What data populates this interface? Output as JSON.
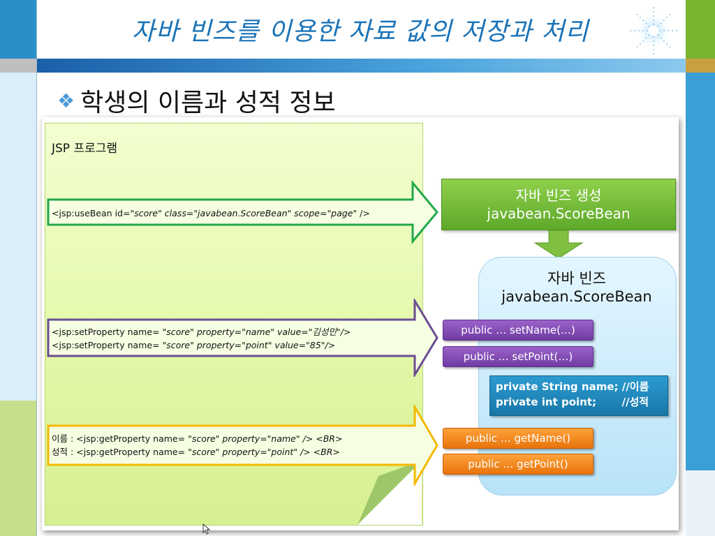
{
  "slide": {
    "title": "자바 빈즈를 이용한 자료 값의 저장과 처리",
    "subtitle": "학생의 이름과 성적 정보",
    "bullet_icon": "diamond-bullet-icon"
  },
  "colors": {
    "title": "#1a73b8",
    "green_arrow": "#21a84a",
    "purple_arrow": "#6a4c93",
    "yellow_arrow": "#f5b800",
    "green_box": "#6cb33a",
    "purple_pill": "#7b44ad",
    "orange_pill": "#f28a1c",
    "blue_box": "#1f87bd",
    "bean_bg": "#cdeefc"
  },
  "diagram": {
    "note_title": "JSP 프로그램",
    "use_bean": {
      "tag": "<jsp:useBean ",
      "id_label": "id=",
      "id_value": "\"score\"",
      "class_label": " class=",
      "class_value": "\"javabean.ScoreBean\"",
      "scope_label": " scope=",
      "scope_value": "\"page\"",
      "close": " />"
    },
    "set_property": [
      {
        "tag": "<jsp:setProperty name=",
        "name": " \"score\"",
        "property": " property=\"name\"",
        "value": " value=\"김성민\"",
        "close": "/>"
      },
      {
        "tag": "<jsp:setProperty name=",
        "name": " \"score\"",
        "property": " property=\"point\"",
        "value": " value=\"85\"",
        "close": "/>"
      }
    ],
    "get_property": [
      {
        "label": "이름 : ",
        "tag": "<jsp:getProperty name=",
        "name": " \"score\"",
        "property": " property=\"name\"",
        "close": " /> <BR>"
      },
      {
        "label": "성적 : ",
        "tag": "<jsp:getProperty name=",
        "name": " \"score\"",
        "property": " property=\"point\"",
        "close": " /> <BR>"
      }
    ],
    "create_box": {
      "line1": "자바 빈즈 생성",
      "line2": "javabean.ScoreBean"
    },
    "bean": {
      "line1": "자바 빈즈",
      "line2": "javabean.ScoreBean"
    },
    "setters": [
      "public … setName(…)",
      "public … setPoint(…)"
    ],
    "fields": [
      "private String name; //이름",
      "private int point;       //성적"
    ],
    "getters": [
      "public … getName()",
      "public … getPoint()"
    ]
  }
}
